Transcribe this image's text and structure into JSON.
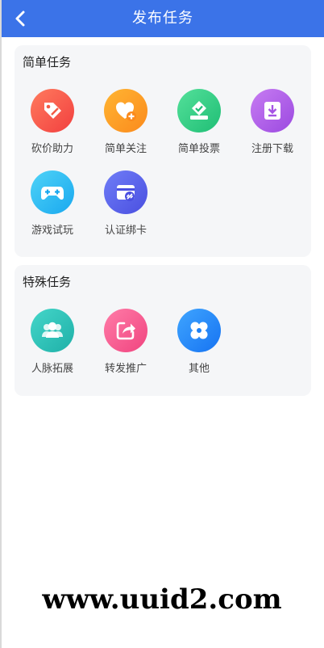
{
  "header": {
    "title": "发布任务",
    "back_icon": "chevron-left-icon"
  },
  "simple_tasks": {
    "title": "简单任务",
    "items": [
      {
        "label": "砍价助力",
        "icon": "price-tag-icon",
        "color_start": "#ff7b5e",
        "color_end": "#f23f3f"
      },
      {
        "label": "简单关注",
        "icon": "heart-plus-icon",
        "color_start": "#ffb533",
        "color_end": "#fb8a1c"
      },
      {
        "label": "简单投票",
        "icon": "vote-box-icon",
        "color_start": "#54e09a",
        "color_end": "#1fbe75"
      },
      {
        "label": "注册下载",
        "icon": "download-icon",
        "color_start": "#c77cf2",
        "color_end": "#9b49e0"
      },
      {
        "label": "游戏试玩",
        "icon": "gamepad-icon",
        "color_start": "#4fd3f7",
        "color_end": "#19a8ef"
      },
      {
        "label": "认证绑卡",
        "icon": "card-link-icon",
        "color_start": "#6f7df7",
        "color_end": "#4a4fe0"
      }
    ]
  },
  "special_tasks": {
    "title": "特殊任务",
    "items": [
      {
        "label": "人脉拓展",
        "icon": "people-icon",
        "color_start": "#44d6c9",
        "color_end": "#1fb0a8"
      },
      {
        "label": "转发推广",
        "icon": "share-icon",
        "color_start": "#ff7ca8",
        "color_end": "#f0447f"
      },
      {
        "label": "其他",
        "icon": "clover-icon",
        "color_start": "#3fa5ff",
        "color_end": "#1673f2"
      }
    ]
  },
  "watermark": "www.uuid2.com"
}
